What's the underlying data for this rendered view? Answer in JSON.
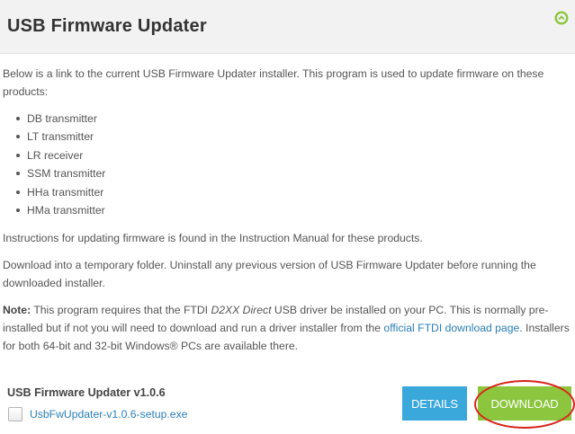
{
  "header": {
    "title": "USB Firmware Updater",
    "collapse_icon": "chevron-up-circle-icon",
    "accent_color": "#8cc63e"
  },
  "intro": {
    "text": "Below is a link to the current USB Firmware Updater installer. This program is used to update firmware on these products:"
  },
  "products": [
    "DB transmitter",
    "LT transmitter",
    "LR receiver",
    "SSM transmitter",
    "HHa transmitter",
    "HMa transmitter"
  ],
  "instructions": {
    "text": "Instructions for updating firmware is found in the Instruction Manual for these products."
  },
  "download_note": {
    "text": "Download into a temporary folder. Uninstall any previous version of USB Firmware Updater before running the downloaded installer."
  },
  "note": {
    "label": "Note:",
    "text_1": " This program requires that the FTDI ",
    "driver_name": "D2XX Direct",
    "text_2": " USB driver be installed on your PC. This is normally pre-installed but if not you will need to download and run a driver installer from the ",
    "link_text": "official FTDI download page",
    "text_3": ". Installers for both 64-bit and 32-bit Windows® PCs are available there."
  },
  "file": {
    "title": "USB Firmware Updater v1.0.6",
    "filename": "UsbFwUpdater-v1.0.6-setup.exe",
    "checkbox_checked": false
  },
  "buttons": {
    "details_label": "DETAILS",
    "download_label": "DOWNLOAD",
    "details_color": "#3ba8dc",
    "download_color": "#8cc63e",
    "highlight_color": "#d9251b"
  }
}
